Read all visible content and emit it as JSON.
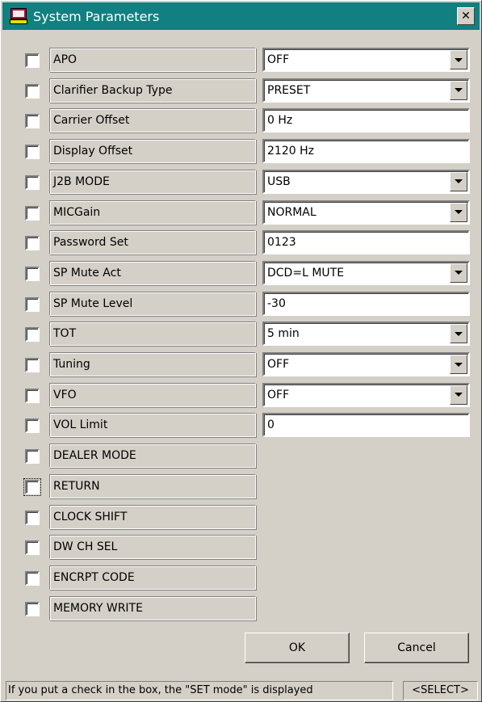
{
  "window": {
    "title": "System Parameters",
    "close_symbol": "✕"
  },
  "params": [
    {
      "label": "APO",
      "type": "select",
      "value": "OFF"
    },
    {
      "label": "Clarifier Backup Type",
      "type": "select",
      "value": "PRESET"
    },
    {
      "label": "Carrier Offset",
      "type": "text",
      "value": "0 Hz"
    },
    {
      "label": "Display Offset",
      "type": "text",
      "value": "2120 Hz"
    },
    {
      "label": "J2B MODE",
      "type": "select",
      "value": "USB"
    },
    {
      "label": "MICGain",
      "type": "select",
      "value": "NORMAL"
    },
    {
      "label": "Password Set",
      "type": "text",
      "value": "0123"
    },
    {
      "label": "SP Mute Act",
      "type": "select",
      "value": "DCD=L MUTE"
    },
    {
      "label": "SP Mute Level",
      "type": "text",
      "value": "-30"
    },
    {
      "label": "TOT",
      "type": "select",
      "value": "5 min"
    },
    {
      "label": "Tuning",
      "type": "select",
      "value": "OFF"
    },
    {
      "label": "VFO",
      "type": "select",
      "value": "OFF"
    },
    {
      "label": "VOL Limit",
      "type": "text",
      "value": "0"
    },
    {
      "label": "DEALER MODE",
      "type": "none",
      "value": ""
    },
    {
      "label": "RETURN",
      "type": "none",
      "value": ""
    },
    {
      "label": "CLOCK SHIFT",
      "type": "none",
      "value": ""
    },
    {
      "label": "DW CH SEL",
      "type": "none",
      "value": ""
    },
    {
      "label": "ENCRPT CODE",
      "type": "none",
      "value": ""
    },
    {
      "label": "MEMORY WRITE",
      "type": "none",
      "value": ""
    }
  ],
  "buttons": {
    "ok_label": "OK",
    "cancel_label": "Cancel"
  },
  "status": {
    "message": "If you put a check in the box, the \"SET mode\" is displayed",
    "mode": "<SELECT>"
  },
  "colors": {
    "title_bar": "#108080",
    "face": "#d4d0c8"
  }
}
